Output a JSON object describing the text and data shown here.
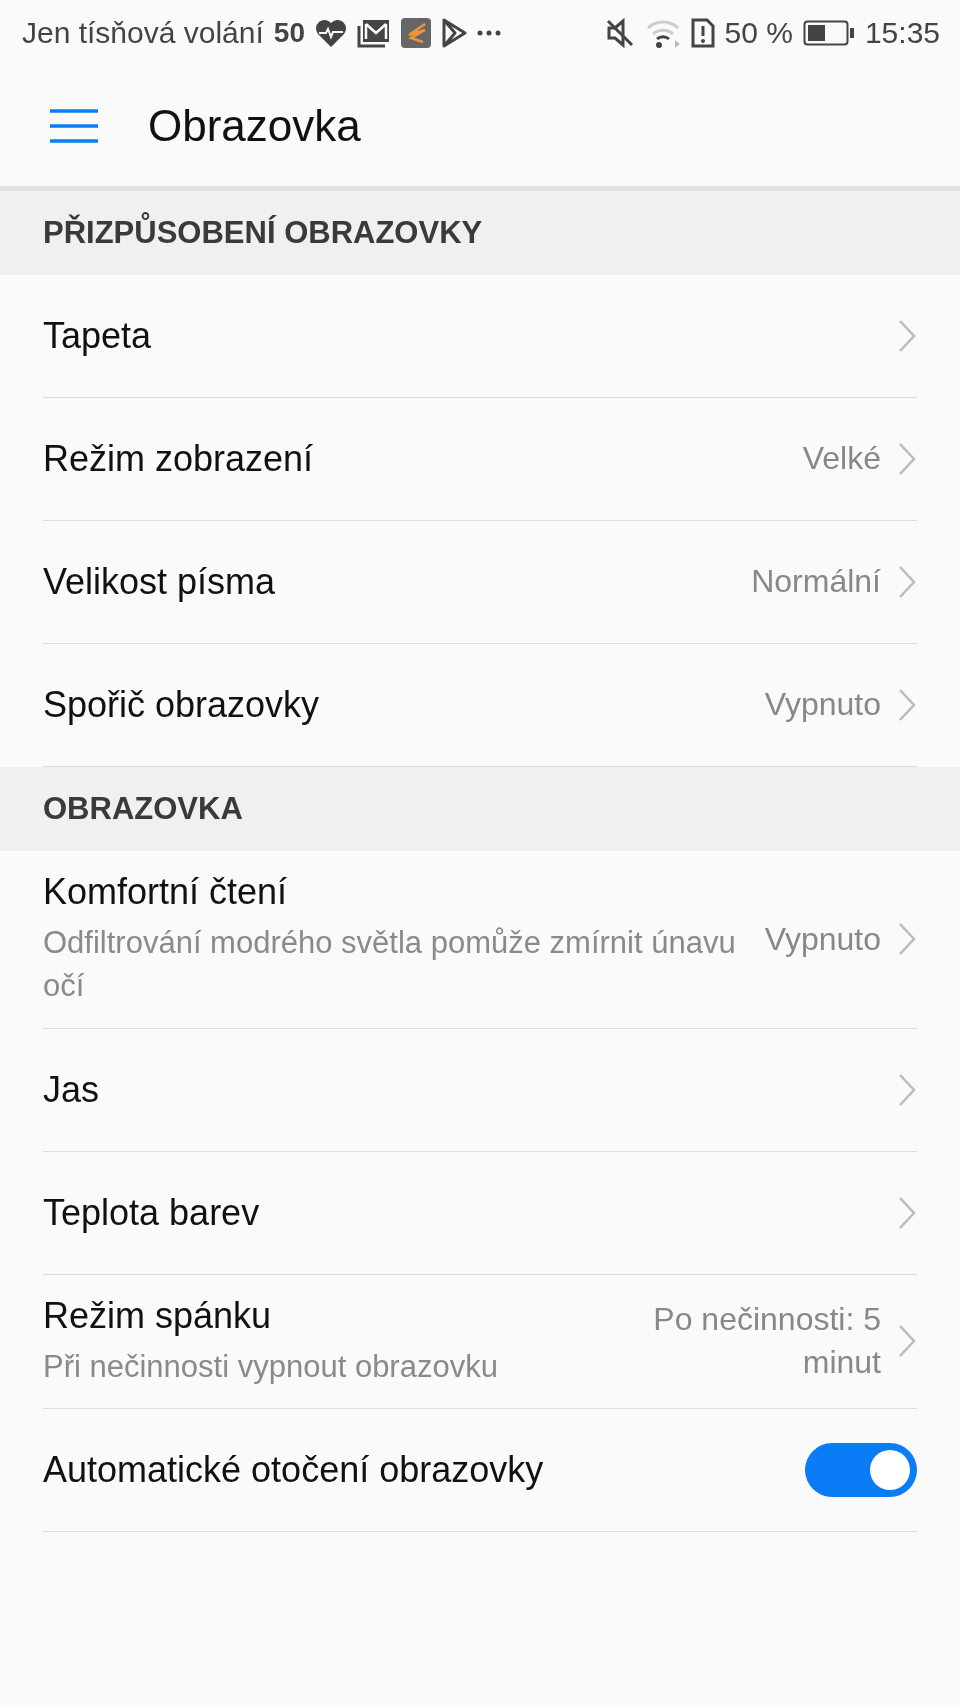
{
  "status_bar": {
    "notice": "Jen tísňová volání",
    "signal_text": "50",
    "battery_text": "50 %",
    "time": "15:35"
  },
  "header": {
    "title": "Obrazovka"
  },
  "sections": [
    {
      "title": "PŘIZPŮSOBENÍ OBRAZOVKY",
      "rows": [
        {
          "kind": "link",
          "title": "Tapeta"
        },
        {
          "kind": "link",
          "title": "Režim zobrazení",
          "value": "Velké"
        },
        {
          "kind": "link",
          "title": "Velikost písma",
          "value": "Normální"
        },
        {
          "kind": "link",
          "title": "Spořič obrazovky",
          "value": "Vypnuto"
        }
      ]
    },
    {
      "title": "OBRAZOVKA",
      "rows": [
        {
          "kind": "link",
          "title": "Komfortní čtení",
          "subtitle": "Odfiltrování modrého světla pomůže zmírnit únavu očí",
          "value": "Vypnuto"
        },
        {
          "kind": "link",
          "title": "Jas"
        },
        {
          "kind": "link",
          "title": "Teplota barev"
        },
        {
          "kind": "link",
          "title": "Režim spánku",
          "subtitle": "Při nečinnosti vypnout obrazovku",
          "value": "Po nečinnosti: 5 minut"
        },
        {
          "kind": "toggle",
          "title": "Automatické otočení obrazovky",
          "on": true
        }
      ]
    }
  ]
}
